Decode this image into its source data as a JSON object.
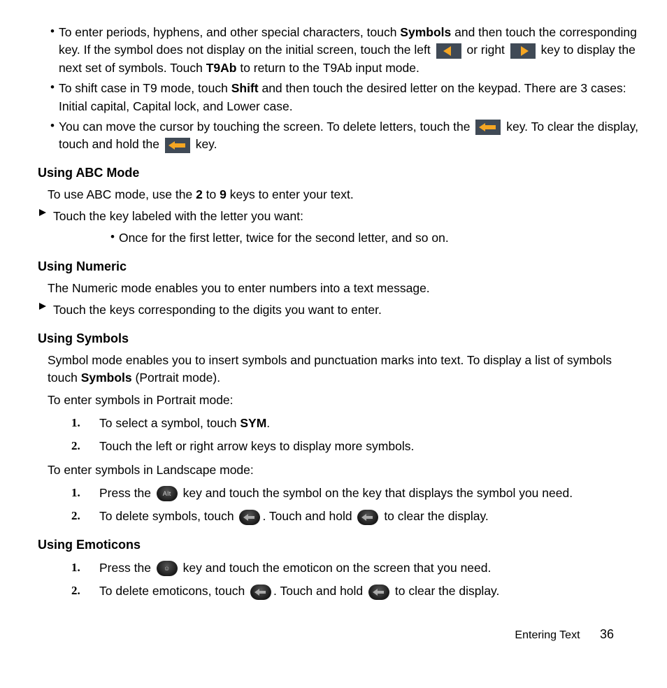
{
  "bullets": {
    "b1a": "To enter periods, hyphens, and other special characters, touch ",
    "b1_sym": "Symbols",
    "b1b": " and then touch the corresponding key. If the symbol does not display on the initial screen, touch the left ",
    "b1c": " or right ",
    "b1d": " key to display the next set of symbols. Touch ",
    "b1_t9": "T9Ab",
    "b1e": " to return to the T9Ab input mode.",
    "b2a": "To shift case in T9 mode, touch ",
    "b2_shift": "Shift",
    "b2b": " and then touch the desired letter on the keypad. There are 3 cases: Initial capital, Capital lock, and Lower case.",
    "b3a": "You can move the cursor by touching the screen. To delete letters, touch the ",
    "b3b": " key. To clear the display, touch and hold the ",
    "b3c": " key."
  },
  "abc": {
    "heading": "Using ABC Mode",
    "p1a": "To use ABC mode, use the ",
    "p1_2": "2",
    "p1b": " to ",
    "p1_9": "9",
    "p1c": " keys to enter your text.",
    "arrow1": "Touch the key labeled with the letter you want:",
    "sub1": "Once for the first letter, twice for the second letter, and so on."
  },
  "numeric": {
    "heading": "Using Numeric",
    "p1": "The Numeric mode enables you to enter numbers into a text message.",
    "arrow1": "Touch the keys corresponding to the digits you want to enter."
  },
  "symbols": {
    "heading": "Using Symbols",
    "p1a": "Symbol mode enables you to insert symbols and punctuation marks into text. To display a list of symbols touch ",
    "p1_sym": "Symbols",
    "p1b": " (Portrait mode).",
    "p2": "To enter symbols in Portrait mode:",
    "ol1a": "To select a symbol, touch ",
    "ol1_sym": "SYM",
    "ol1b": ".",
    "ol2": "Touch the left or right arrow keys to display more symbols.",
    "p3": "To enter symbols in Landscape mode:",
    "ol3a": "Press the ",
    "ol3b": " key and touch the symbol on the key that displays the symbol you need.",
    "ol4a": "To delete symbols, touch ",
    "ol4b": ". Touch and hold ",
    "ol4c": " to clear the display."
  },
  "emoticons": {
    "heading": "Using Emoticons",
    "ol1a": "Press the ",
    "ol1b": " key and touch the emoticon on the screen that you need.",
    "ol2a": "To delete emoticons, touch ",
    "ol2b": ". Touch and hold ",
    "ol2c": " to clear the display."
  },
  "footer": {
    "section": "Entering Text",
    "page": "36"
  },
  "nums": {
    "n1": "1.",
    "n2": "2."
  },
  "altLabel": "Alt",
  "emoLabel": "☺"
}
